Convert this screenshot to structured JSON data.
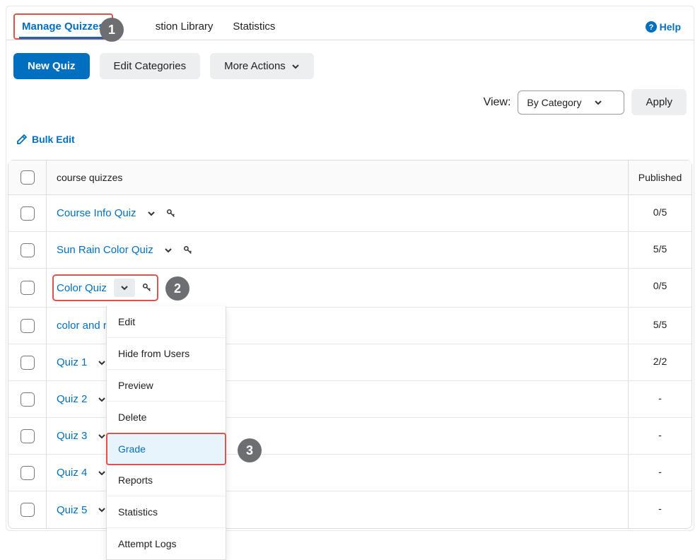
{
  "tabs": {
    "manage": "Manage Quizzes",
    "library": "stion Library",
    "statistics": "Statistics"
  },
  "help": {
    "label": "Help"
  },
  "toolbar": {
    "new_quiz": "New Quiz",
    "edit_categories": "Edit Categories",
    "more_actions": "More Actions"
  },
  "view": {
    "label": "View:",
    "selected": "By Category",
    "apply": "Apply"
  },
  "bulk_edit": {
    "label": "Bulk Edit"
  },
  "table": {
    "header_name": "course quizzes",
    "header_published": "Published",
    "rows": [
      {
        "name": "Course Info Quiz",
        "published": "0/5",
        "has_key": true
      },
      {
        "name": "Sun Rain Color Quiz",
        "published": "5/5",
        "has_key": true
      },
      {
        "name": "Color Quiz",
        "published": "0/5",
        "has_key": true
      },
      {
        "name": "color and ra",
        "published": "5/5",
        "has_key": false
      },
      {
        "name": "Quiz 1",
        "published": "2/2",
        "has_key": false
      },
      {
        "name": "Quiz 2",
        "published": "-",
        "has_key": false
      },
      {
        "name": "Quiz 3",
        "published": "-",
        "has_key": false
      },
      {
        "name": "Quiz 4",
        "published": "-",
        "has_key": false
      },
      {
        "name": "Quiz 5",
        "published": "-",
        "has_key": false
      }
    ]
  },
  "dropdown": {
    "items": [
      "Edit",
      "Hide from Users",
      "Preview",
      "Delete",
      "Grade",
      "Reports",
      "Statistics",
      "Attempt Logs"
    ],
    "highlighted_index": 4
  },
  "callouts": {
    "1": "1",
    "2": "2",
    "3": "3"
  }
}
